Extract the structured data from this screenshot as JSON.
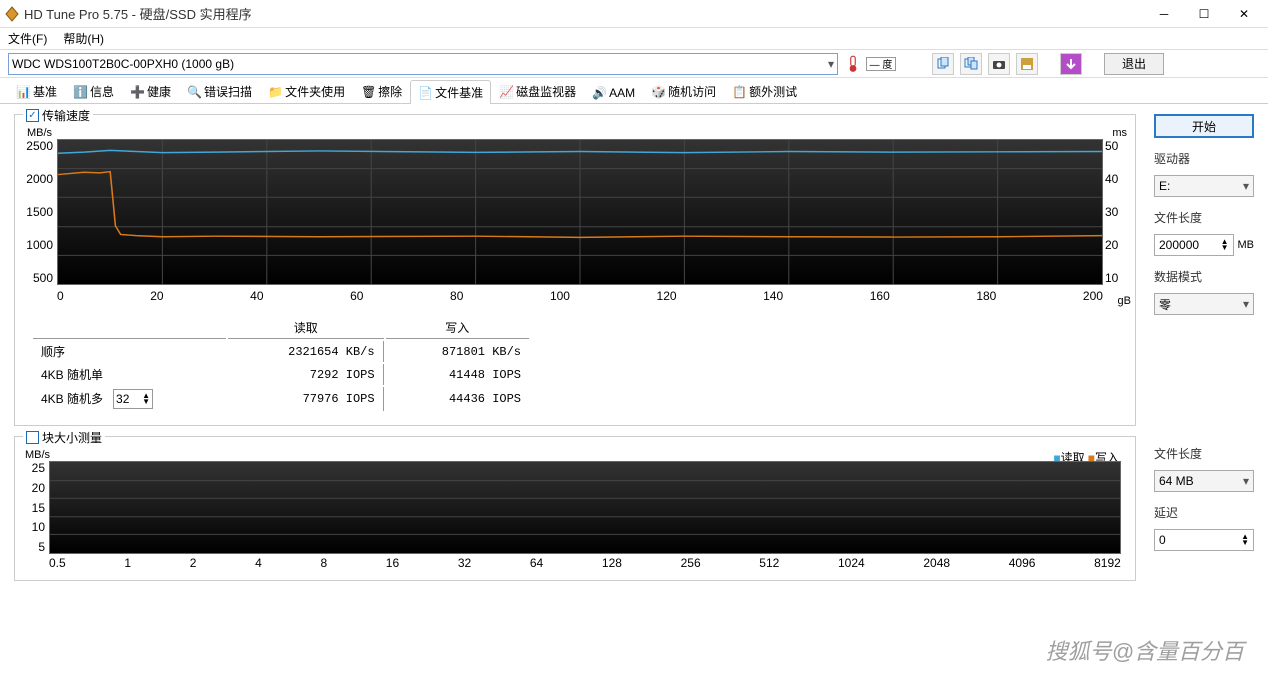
{
  "window": {
    "title": "HD Tune Pro 5.75 - 硬盘/SSD 实用程序"
  },
  "menu": {
    "file": "文件(F)",
    "help": "帮助(H)"
  },
  "toolbar": {
    "drive": "WDC WDS100T2B0C-00PXH0 (1000 gB)",
    "temp": "— 度",
    "exit": "退出"
  },
  "tabs": {
    "benchmark": "基准",
    "info": "信息",
    "health": "健康",
    "errorscan": "错误扫描",
    "folder": "文件夹使用",
    "erase": "擦除",
    "filebench": "文件基准",
    "diskmon": "磁盘监视器",
    "aam": "AAM",
    "random": "随机访问",
    "extra": "额外测试"
  },
  "section1": {
    "checkbox": "传输速度",
    "ylabel_l": "MB/s",
    "ylabel_r": "ms",
    "yt_left": [
      "2500",
      "2000",
      "1500",
      "1000",
      "500"
    ],
    "yt_right": [
      "50",
      "40",
      "30",
      "20",
      "10"
    ],
    "xt": [
      "0",
      "20",
      "40",
      "60",
      "80",
      "100",
      "120",
      "140",
      "160",
      "180",
      "200"
    ],
    "xunit": "gB",
    "hdr_read": "读取",
    "hdr_write": "写入",
    "rows": {
      "seq": "顺序",
      "seq_r": "2321654 KB/s",
      "seq_w": "871801 KB/s",
      "r4s": "4KB 随机单",
      "r4s_r": "7292 IOPS",
      "r4s_w": "41448 IOPS",
      "r4m": "4KB 随机多",
      "r4m_r": "77976 IOPS",
      "r4m_w": "44436 IOPS",
      "qd": "32"
    }
  },
  "section2": {
    "checkbox": "块大小测量",
    "ylabel": "MB/s",
    "yt": [
      "25",
      "20",
      "15",
      "10",
      "5"
    ],
    "xt": [
      "0.5",
      "1",
      "2",
      "4",
      "8",
      "16",
      "32",
      "64",
      "128",
      "256",
      "512",
      "1024",
      "2048",
      "4096",
      "8192"
    ],
    "legend_r": "读取",
    "legend_w": "写入"
  },
  "panel": {
    "start": "开始",
    "drive_lbl": "驱动器",
    "drive_val": "E:",
    "filelen_lbl": "文件长度",
    "filelen_val": "200000",
    "filelen_suffix": "MB",
    "mode_lbl": "数据模式",
    "mode_val": "零",
    "filelen2_lbl": "文件长度",
    "filelen2_val": "64 MB",
    "delay_lbl": "延迟",
    "delay_val": "0"
  },
  "watermark": "搜狐号@含量百分百",
  "chart_data": {
    "type": "line",
    "title": "",
    "xlabel": "gB",
    "ylabel": "MB/s",
    "ylabel_right": "ms",
    "xlim": [
      0,
      200
    ],
    "ylim_left": [
      0,
      2500
    ],
    "ylim_right": [
      0,
      50
    ],
    "series": [
      {
        "name": "读取",
        "color": "#3fa8d8",
        "axis": "left",
        "x": [
          0,
          5,
          10,
          15,
          20,
          30,
          50,
          80,
          100,
          120,
          140,
          160,
          180,
          200
        ],
        "y": [
          2270,
          2290,
          2320,
          2300,
          2280,
          2290,
          2310,
          2285,
          2300,
          2280,
          2300,
          2290,
          2295,
          2300
        ]
      },
      {
        "name": "写入",
        "color": "#d97a1a",
        "axis": "left",
        "x": [
          0,
          5,
          8,
          10,
          11,
          12,
          15,
          20,
          30,
          50,
          80,
          100,
          120,
          140,
          160,
          180,
          200
        ],
        "y": [
          1900,
          1940,
          1930,
          1950,
          1010,
          860,
          840,
          820,
          830,
          820,
          830,
          810,
          830,
          820,
          815,
          820,
          840
        ]
      }
    ]
  }
}
